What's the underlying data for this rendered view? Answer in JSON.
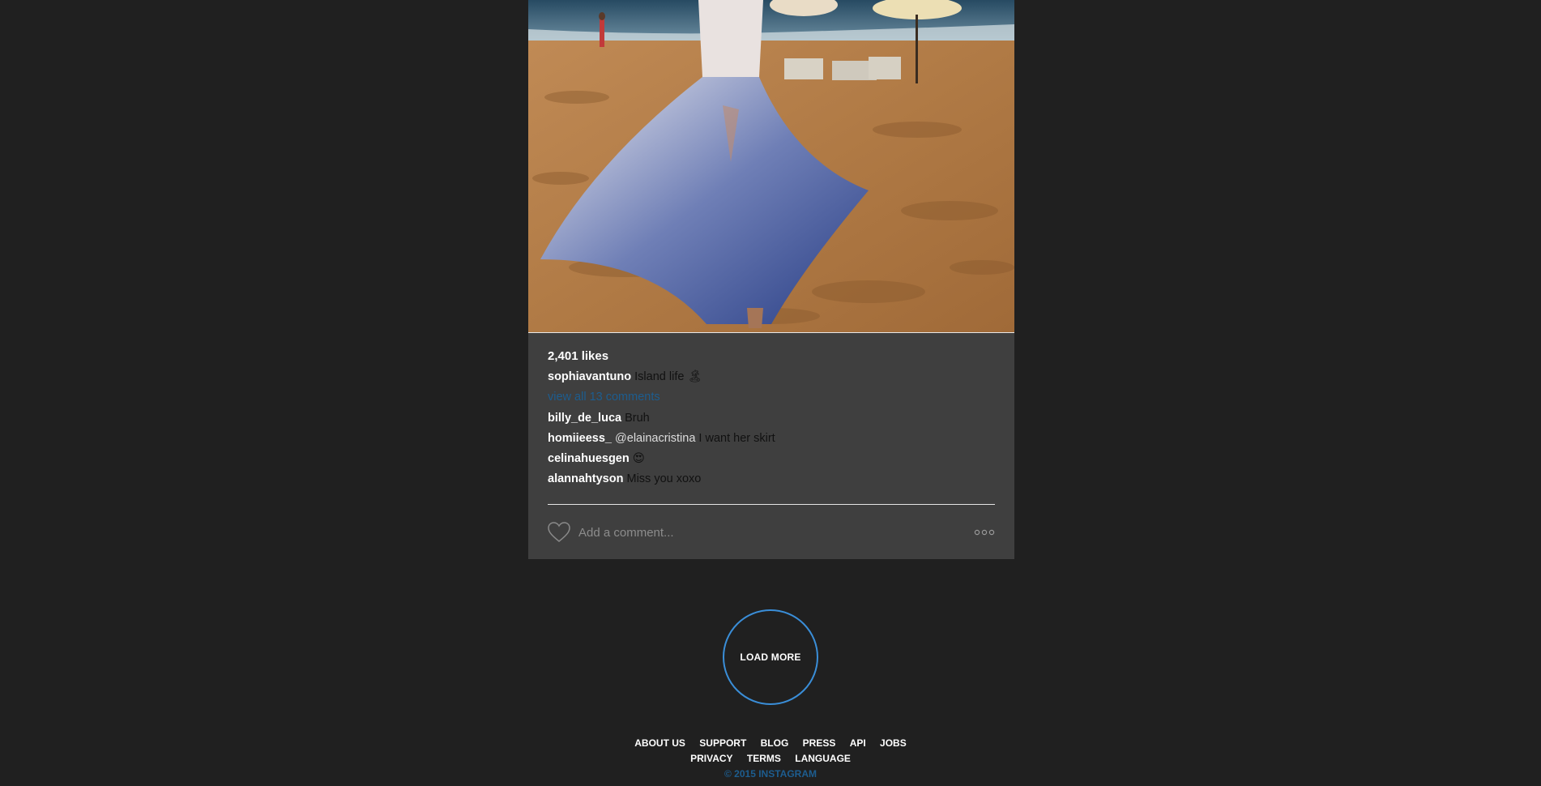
{
  "post": {
    "likes": "2,401 likes",
    "caption": {
      "user": "sophiavantuno",
      "text": "Island life 🏝"
    },
    "view_all": "view all 13 comments",
    "comments": [
      {
        "user": "billy_de_luca",
        "mention": "",
        "text": "Bruh"
      },
      {
        "user": "homiieess_",
        "mention": "@elainacristina",
        "text": "I want her skirt"
      },
      {
        "user": "celinahuesgen",
        "mention": "",
        "text": "😍"
      },
      {
        "user": "alannahtyson",
        "mention": "",
        "text": "Miss you xoxo"
      }
    ],
    "comment_placeholder": "Add a comment...",
    "icons": {
      "like": "heart-icon",
      "options": "more-options-icon"
    }
  },
  "load_more": "LOAD MORE",
  "footer": {
    "row1": [
      "ABOUT US",
      "SUPPORT",
      "BLOG",
      "PRESS",
      "API",
      "JOBS"
    ],
    "row2": [
      "PRIVACY",
      "TERMS",
      "LANGUAGE"
    ],
    "copyright": "© 2015 INSTAGRAM"
  },
  "colors": {
    "page_background": "#202020",
    "card_background": "#3f3f3f",
    "link_blue": "#1d5d8f",
    "accent_blue": "#3a8ed8"
  }
}
